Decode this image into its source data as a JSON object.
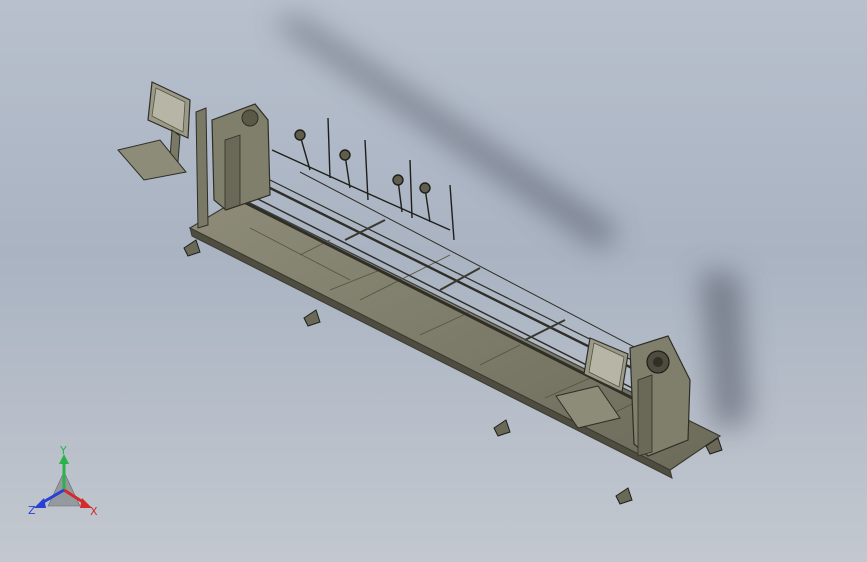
{
  "triad": {
    "x_label": "X",
    "y_label": "Y",
    "z_label": "Z",
    "x_color": "#d42a2a",
    "y_color": "#2bb24a",
    "z_color": "#2a3fd4"
  },
  "colors": {
    "frame": "#6f6e5c",
    "frame_light": "#9a9986",
    "frame_dark": "#3c3b33",
    "shadow": "#4b5160"
  }
}
